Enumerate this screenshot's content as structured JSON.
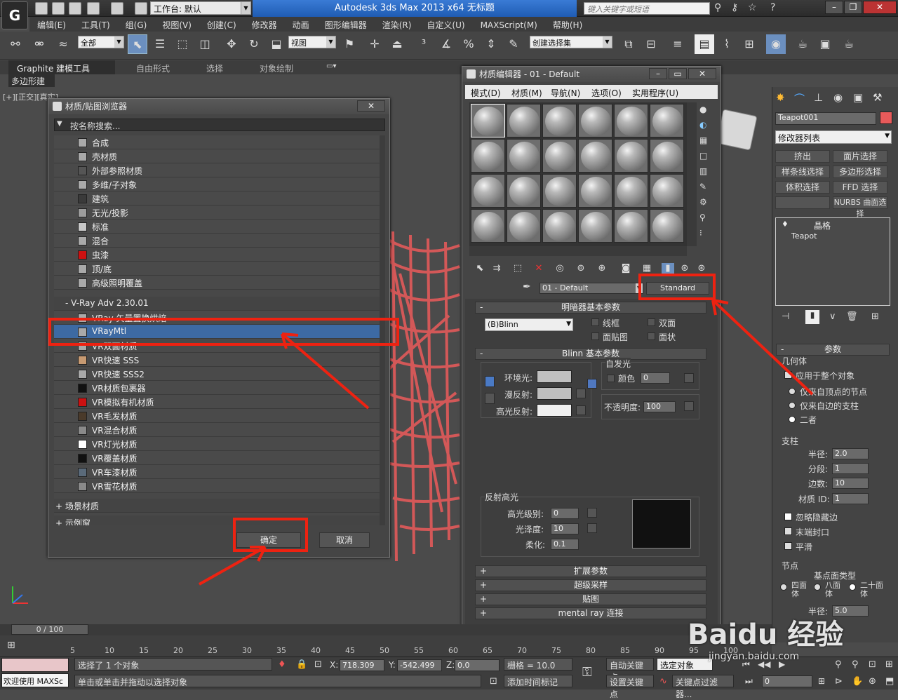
{
  "titlebar": {
    "workspace": "工作台: 默认",
    "app_title": "Autodesk 3ds Max  2013 x64      无标题",
    "search_placeholder": "键入关键字或短语"
  },
  "menu": [
    "编辑(E)",
    "工具(T)",
    "组(G)",
    "视图(V)",
    "创建(C)",
    "修改器",
    "动画",
    "图形编辑器",
    "渲染(R)",
    "自定义(U)",
    "MAXScript(M)",
    "帮助(H)"
  ],
  "toolbar": {
    "selection_filter": "全部",
    "ref_coord": "视图",
    "selection_set": "创建选择集"
  },
  "ribbon": {
    "tabs": [
      "Graphite 建模工具",
      "自由形式",
      "选择",
      "对象绘制"
    ],
    "sub": "多边形建模"
  },
  "viewport": {
    "label": "[+][正交][真实]"
  },
  "browser": {
    "title": "材质/贴图浏览器",
    "search_placeholder": "按名称搜索...",
    "standard_items": [
      "合成",
      "壳材质",
      "外部参照材质",
      "多维/子对象",
      "建筑",
      "无光/投影",
      "标准",
      "混合",
      "虫漆",
      "顶/底",
      "高级照明覆盖"
    ],
    "standard_colors": [
      "#a9a9a9",
      "#a9a9a9",
      "#555555",
      "#a9a9a9",
      "#3a3a3a",
      "#9c9c9c",
      "#c9c9c9",
      "#a9a9a9",
      "#cc1111",
      "#a9a9a9",
      "#a9a9a9"
    ],
    "vray_group": "- V-Ray Adv 2.30.01",
    "vray_items": [
      "VRay 矢量置换烘焙",
      "VRayMtl",
      "VR双面材质",
      "VR快速 SSS",
      "VR快速 SSS2",
      "VR材质包裹器",
      "VR模拟有机材质",
      "VR毛发材质",
      "VR混合材质",
      "VR灯光材质",
      "VR覆盖材质",
      "VR车漆材质",
      "VR雪花材质"
    ],
    "vray_colors": [
      "#a9a9a9",
      "#a9a9a9",
      "#a9a9a9",
      "#c79a72",
      "#a9a9a9",
      "#111111",
      "#cc1111",
      "#4a3a2a",
      "#8a8a8a",
      "#ffffff",
      "#111111",
      "#5a6a7a",
      "#8a8a8a"
    ],
    "scene_group": "+ 场景材质",
    "sample_group": "+ 示例窗",
    "ok": "确定",
    "cancel": "取消"
  },
  "editor": {
    "title": "材质编辑器 - 01 - Default",
    "menus": [
      "模式(D)",
      "材质(M)",
      "导航(N)",
      "选项(O)",
      "实用程序(U)"
    ],
    "mat_name": "01 - Default",
    "mat_type": "Standard",
    "shader_rollout": "明暗器基本参数",
    "shader": "(B)Blinn",
    "wire": "线框",
    "two_sided": "双面",
    "face_map": "面贴图",
    "faceted": "面状",
    "blinn_rollout": "Blinn 基本参数",
    "self_illum": "自发光",
    "color_lbl": "颜色",
    "self_illum_val": "0",
    "ambient": "环境光:",
    "diffuse": "漫反射:",
    "specular": "高光反射:",
    "opacity": "不透明度:",
    "opacity_val": "100",
    "spec_hl": "反射高光",
    "spec_level": "高光级别:",
    "spec_level_val": "0",
    "gloss": "光泽度:",
    "gloss_val": "10",
    "soften": "柔化:",
    "soften_val": "0.1",
    "rollouts": [
      "扩展参数",
      "超级采样",
      "贴图",
      "mental ray 连接"
    ]
  },
  "cmd": {
    "obj_name": "Teapot001",
    "mod_list": "修改器列表",
    "buttons": [
      "挤出",
      "面片选择",
      "样条线选择",
      "多边形选择",
      "体积选择",
      "FFD 选择",
      "",
      "NURBS 曲面选择"
    ],
    "stack_top": "晶格",
    "stack_item": "Teapot",
    "params": "参数",
    "geometry": "几何体",
    "apply_all": "应用于整个对象",
    "joints_only": "仅来自顶点的节点",
    "struts_only": "仅来自边的支柱",
    "both": "二者",
    "struts": "支柱",
    "radius": "半径:",
    "radius_val": "2.0",
    "segments": "分段:",
    "segments_val": "1",
    "sides": "边数:",
    "sides_val": "10",
    "mat_id": "材质 ID:",
    "mat_id_val": "1",
    "ignore_hidden": "忽略隐藏边",
    "end_caps": "末端封口",
    "smooth": "平滑",
    "joints": "节点",
    "base_type": "基点面类型",
    "tetra": "四面体",
    "octa": "八面体",
    "icosa": "二十面体",
    "j_radius": "半径:",
    "j_radius_val": "5.0"
  },
  "timeline": {
    "frame": "0 / 100",
    "ticks": [
      "5",
      "10",
      "15",
      "20",
      "25",
      "30",
      "35",
      "40",
      "45",
      "50",
      "55",
      "60",
      "65",
      "70",
      "75",
      "80",
      "85",
      "90",
      "95",
      "100"
    ]
  },
  "status": {
    "welcome": "欢迎使用 MAXSc",
    "selected": "选择了 1 个对象",
    "prompt": "单击或单击并拖动以选择对象",
    "x_lbl": "X:",
    "x_val": "718.309",
    "y_lbl": "Y:",
    "y_val": "-542.499",
    "z_lbl": "Z:",
    "z_val": "0.0",
    "grid": "栅格 = 10.0",
    "add_time_tag": "添加时间标记",
    "auto_key": "自动关键点",
    "selected_obj": "选定对象",
    "set_key": "设置关键点",
    "key_filter": "关键点过滤器...",
    "frame_field": "0"
  },
  "watermark": "Baidu 经验",
  "watermark_url": "jingyan.baidu.com"
}
